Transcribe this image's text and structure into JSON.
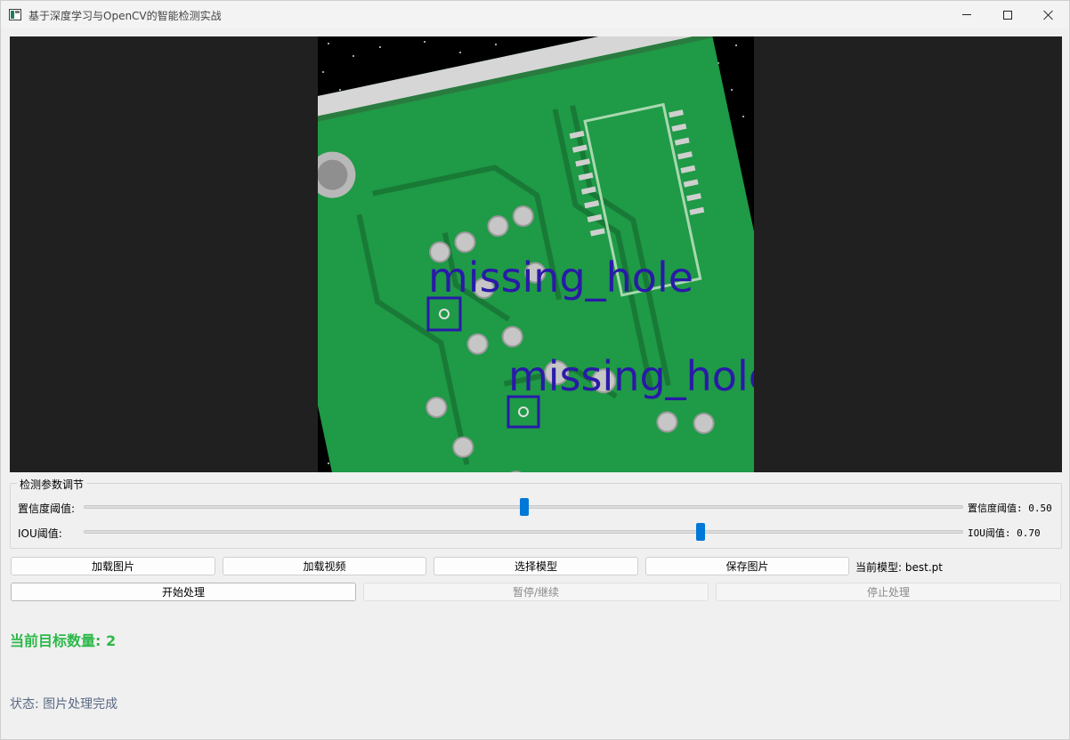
{
  "window": {
    "title": "基于深度学习与OpenCV的智能检测实战",
    "controls": [
      "minimize-icon",
      "maximize-icon",
      "close-icon"
    ]
  },
  "display": {
    "detections": [
      {
        "label": "missing_hole"
      },
      {
        "label": "missing_hole"
      }
    ],
    "box_color": "#2a1aa8",
    "board_color": "#1f9a46"
  },
  "params": {
    "group_title": "检测参数调节",
    "confidence": {
      "label": "置信度阈值:",
      "value_label": "置信度阈值: 0.50",
      "value": 0.5
    },
    "iou": {
      "label": "IOU阈值:",
      "value_label": "IOU阈值: 0.70",
      "value": 0.7
    }
  },
  "toolbar": {
    "load_image": "加载图片",
    "load_video": "加载视频",
    "select_model": "选择模型",
    "save_image": "保存图片",
    "current_model": "当前模型: best.pt"
  },
  "controls": {
    "start": "开始处理",
    "pause": "暂停/继续",
    "stop": "停止处理"
  },
  "info": {
    "target_count": "当前目标数量: 2",
    "status": "状态: 图片处理完成"
  },
  "colors": {
    "accent": "#0078d7",
    "count_text": "#2db84a",
    "status_text": "#5a6a85"
  }
}
